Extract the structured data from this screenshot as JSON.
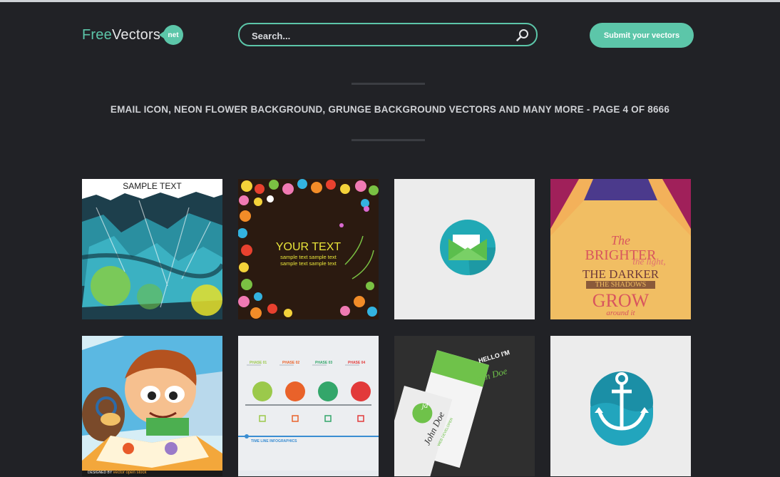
{
  "header": {
    "logo": {
      "free": "Free",
      "vectors": "Vectors",
      "badge": "net"
    },
    "search": {
      "placeholder": "Search..."
    },
    "submit_label": "Submit your vectors"
  },
  "main": {
    "title": "EMAIL ICON, NEON FLOWER BACKGROUND, GRUNGE BACKGROUND VECTORS AND MANY MORE - PAGE 4 OF 8666"
  },
  "thumbnails": [
    {
      "subject": "grunge-background",
      "text": "SAMPLE TEXT"
    },
    {
      "subject": "neon-flower-background",
      "text": "YOUR TEXT",
      "subtext_1": "sample text sample text",
      "subtext_2": "sample text sample text"
    },
    {
      "subject": "email-icon"
    },
    {
      "subject": "typography-poster",
      "line_1": "The",
      "line_2": "BRIGHTER",
      "line_3": "the light,",
      "line_4": "THE DARKER",
      "line_5": "THE SHADOWS",
      "line_6": "GROW",
      "line_7": "around it"
    },
    {
      "subject": "kids-reading-illustration",
      "credit_1": "DESIGNED BY",
      "credit_2": "vector open stock"
    },
    {
      "subject": "timeline-infographics",
      "phases": [
        "PHASE 01",
        "PHASE 02",
        "PHASE 03",
        "PHASE 04"
      ],
      "footer": "TIME LINE INFOGRAPHICS"
    },
    {
      "subject": "business-card",
      "greeting": "HELLO I'M",
      "name": "John Doe",
      "role": "WEB DEVELOPER",
      "monogram": "jd"
    },
    {
      "subject": "anchor-icon"
    }
  ],
  "colors": {
    "background": "#212226",
    "accent": "#5cc6a9",
    "text": "#cfd1d5"
  }
}
